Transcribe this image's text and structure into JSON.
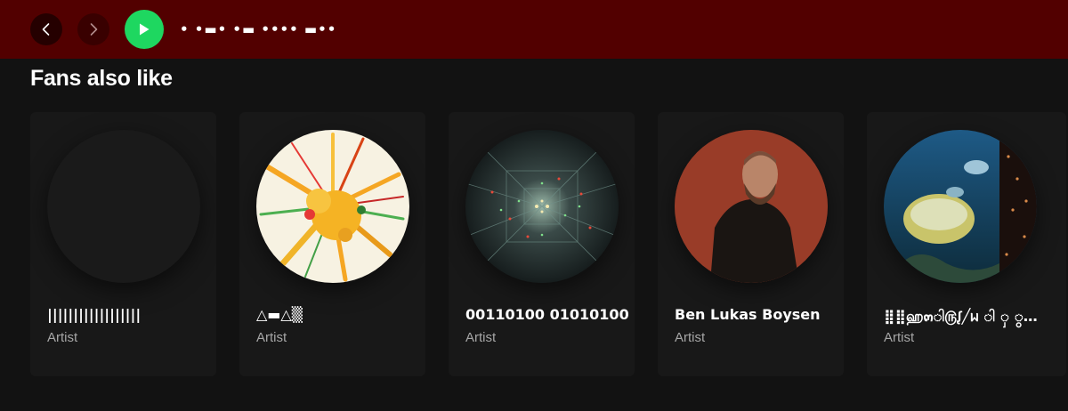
{
  "topbar": {
    "title": "• •▬• •▬ •••• ▬••",
    "back_icon": "chevron-left-icon",
    "forward_icon": "chevron-right-icon",
    "play_icon": "play-icon",
    "accent": "#1ed760",
    "bar_color": "#520000"
  },
  "section": {
    "title": "Fans also like"
  },
  "artists": [
    {
      "name": "||||||||||||||||||",
      "type": "Artist"
    },
    {
      "name": "△▬△▒",
      "type": "Artist"
    },
    {
      "name": "00110100 01010100",
      "type": "Artist"
    },
    {
      "name": "Ben Lukas Boysen",
      "type": "Artist"
    },
    {
      "name": "⣿⣿ஹ๓ါ௫ᶘ╱ᥕ ါ ှ ွ…",
      "type": "Artist"
    }
  ]
}
